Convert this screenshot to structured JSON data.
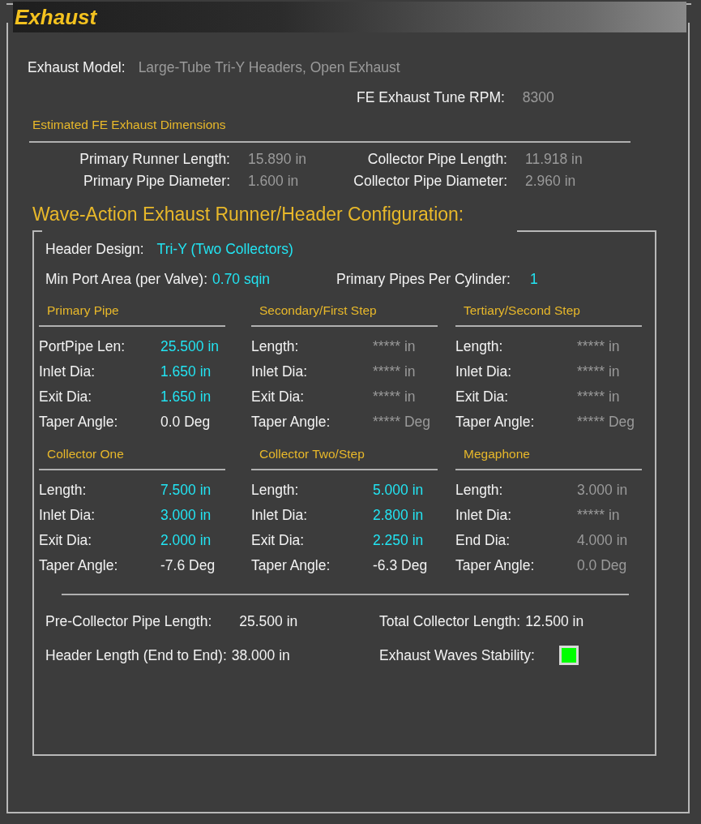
{
  "title": "Exhaust",
  "model": {
    "label": "Exhaust Model:",
    "value": "Large-Tube Tri-Y Headers, Open Exhaust",
    "kind": "disabled"
  },
  "tune_rpm": {
    "label": "FE Exhaust Tune RPM:",
    "value": "8300",
    "kind": "disabled"
  },
  "estimated": {
    "title": "Estimated FE Exhaust Dimensions",
    "fields": [
      {
        "label": "Primary Runner Length:",
        "value": "15.890 in",
        "kind": "disabled"
      },
      {
        "label": "Collector Pipe Length:",
        "value": "11.918 in",
        "kind": "disabled"
      },
      {
        "label": "Primary Pipe Diameter:",
        "value": "1.600 in",
        "kind": "disabled"
      },
      {
        "label": "Collector Pipe Diameter:",
        "value": "2.960 in",
        "kind": "disabled"
      }
    ]
  },
  "wave": {
    "title": "Wave-Action Exhaust Runner/Header Configuration:",
    "header_design": {
      "label": "Header Design:",
      "value": "Tri-Y (Two Collectors)",
      "kind": "input"
    },
    "min_port_area": {
      "label": "Min Port Area (per Valve):",
      "value": "0.70 sqin",
      "kind": "input"
    },
    "pipes_per_cylinder": {
      "label": "Primary Pipes Per Cylinder:",
      "value": "1",
      "kind": "input"
    },
    "sections": [
      {
        "title": "Primary Pipe",
        "rows": [
          {
            "label": "PortPipe Len:",
            "value": "25.500 in",
            "kind": "input"
          },
          {
            "label": "Inlet Dia:",
            "value": "1.650 in",
            "kind": "input"
          },
          {
            "label": "Exit Dia:",
            "value": "1.650 in",
            "kind": "input"
          },
          {
            "label": "Taper Angle:",
            "value": "0.0 Deg",
            "kind": "computed"
          }
        ]
      },
      {
        "title": "Secondary/First Step",
        "rows": [
          {
            "label": "Length:",
            "value": "***** in",
            "kind": "disabled"
          },
          {
            "label": "Inlet Dia:",
            "value": "***** in",
            "kind": "disabled"
          },
          {
            "label": "Exit Dia:",
            "value": "***** in",
            "kind": "disabled"
          },
          {
            "label": "Taper Angle:",
            "value": "***** Deg",
            "kind": "disabled"
          }
        ]
      },
      {
        "title": "Tertiary/Second Step",
        "rows": [
          {
            "label": "Length:",
            "value": "***** in",
            "kind": "disabled"
          },
          {
            "label": "Inlet Dia:",
            "value": "***** in",
            "kind": "disabled"
          },
          {
            "label": "Exit Dia:",
            "value": "***** in",
            "kind": "disabled"
          },
          {
            "label": "Taper Angle:",
            "value": "***** Deg",
            "kind": "disabled"
          }
        ]
      },
      {
        "title": "Collector One",
        "rows": [
          {
            "label": "Length:",
            "value": "7.500 in",
            "kind": "input"
          },
          {
            "label": "Inlet Dia:",
            "value": "3.000 in",
            "kind": "input"
          },
          {
            "label": "Exit Dia:",
            "value": "2.000 in",
            "kind": "input"
          },
          {
            "label": "Taper Angle:",
            "value": "-7.6 Deg",
            "kind": "computed"
          }
        ]
      },
      {
        "title": "Collector Two/Step",
        "rows": [
          {
            "label": "Length:",
            "value": "5.000 in",
            "kind": "input"
          },
          {
            "label": "Inlet Dia:",
            "value": "2.800 in",
            "kind": "input"
          },
          {
            "label": "Exit Dia:",
            "value": "2.250 in",
            "kind": "input"
          },
          {
            "label": "Taper Angle:",
            "value": "-6.3 Deg",
            "kind": "computed"
          }
        ]
      },
      {
        "title": "Megaphone",
        "rows": [
          {
            "label": "Length:",
            "value": "3.000 in",
            "kind": "disabled"
          },
          {
            "label": "Inlet Dia:",
            "value": "***** in",
            "kind": "disabled"
          },
          {
            "label": "End Dia:",
            "value": "4.000 in",
            "kind": "disabled"
          },
          {
            "label": "Taper Angle:",
            "value": "0.0 Deg",
            "kind": "disabled"
          }
        ]
      }
    ],
    "summary": [
      {
        "label": "Pre-Collector Pipe Length:",
        "value": "25.500 in",
        "kind": "computed"
      },
      {
        "label": "Total Collector Length:",
        "value": "12.500 in",
        "kind": "computed"
      },
      {
        "label": "Header Length (End to End):",
        "value": "38.000 in",
        "kind": "computed"
      }
    ],
    "stability": {
      "label": "Exhaust Waves Stability:",
      "color": "#00ff00"
    }
  }
}
